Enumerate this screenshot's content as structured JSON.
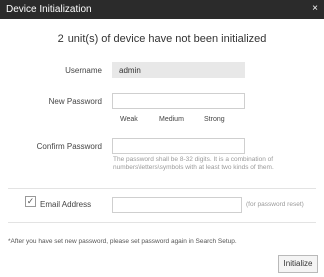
{
  "dialog": {
    "title": "Device Initialization",
    "close_glyph": "×"
  },
  "status": {
    "count": "2",
    "message": "unit(s) of device have not been initialized"
  },
  "form": {
    "username_label": "Username",
    "username_value": "admin",
    "new_password_label": "New Password",
    "new_password_value": "",
    "strength_levels": [
      "Weak",
      "Medium",
      "Strong"
    ],
    "confirm_password_label": "Confirm Password",
    "confirm_password_value": "",
    "password_hint": "The password shall be 8-32 digits. It is a combination of numbers\\letters\\symbols with at least two kinds of them.",
    "email_checkbox_checked": true,
    "email_checkbox_glyph": "✓",
    "email_label": "Email Address",
    "email_value": "",
    "email_note": "(for password reset)"
  },
  "footer": {
    "note": "*After you have set new password, please set password again in Search Setup.",
    "initialize_label": "Initialize"
  }
}
